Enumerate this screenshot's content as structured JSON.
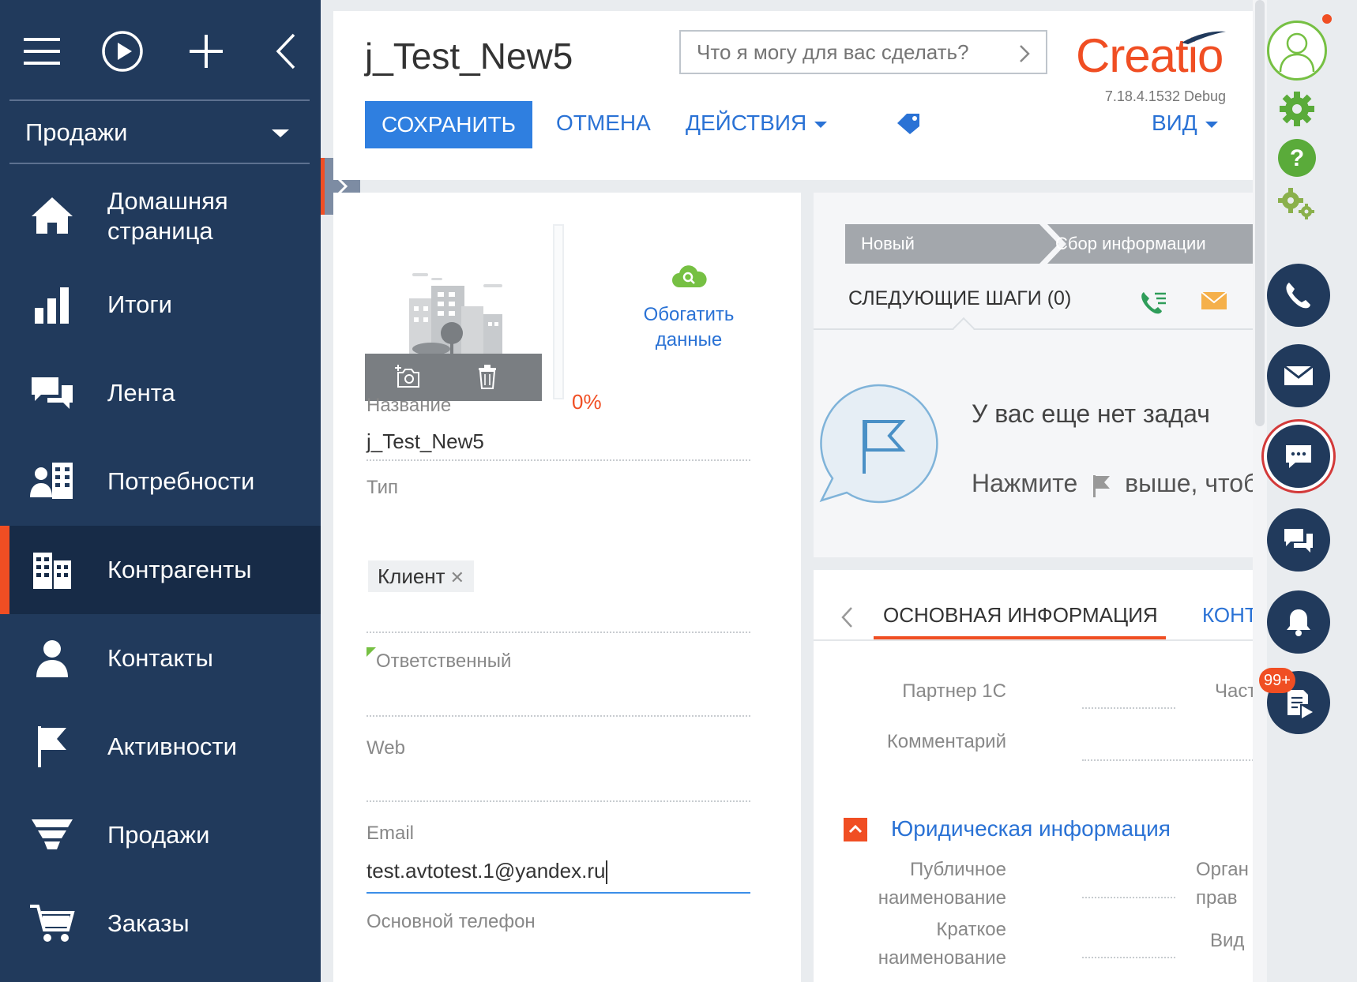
{
  "sidebar": {
    "section": "Продажи",
    "items": [
      {
        "label": "Домашняя страница",
        "icon": "home-icon"
      },
      {
        "label": "Итоги",
        "icon": "bar-chart-icon"
      },
      {
        "label": "Лента",
        "icon": "chat-bubbles-icon"
      },
      {
        "label": "Потребности",
        "icon": "needs-icon"
      },
      {
        "label": "Контрагенты",
        "icon": "buildings-icon",
        "active": true
      },
      {
        "label": "Контакты",
        "icon": "person-icon"
      },
      {
        "label": "Активности",
        "icon": "flag-icon"
      },
      {
        "label": "Продажи",
        "icon": "funnel-icon"
      },
      {
        "label": "Заказы",
        "icon": "cart-icon"
      }
    ]
  },
  "header": {
    "title": "j_Test_New5",
    "search_placeholder": "Что я могу для вас сделать?",
    "logo": "Creatio",
    "version": "7.18.4.1532 Debug",
    "save_label": "СОХРАНИТЬ",
    "cancel_label": "ОТМЕНА",
    "actions_label": "ДЕЙСТВИЯ",
    "view_label": "ВИД"
  },
  "profile": {
    "progress_percent": 0,
    "progress_label": "0%",
    "enrich_label": "Обогатить данные"
  },
  "form": {
    "name_label": "Название",
    "name_value": "j_Test_New5",
    "type_label": "Тип",
    "type_value": "Клиент",
    "owner_label": "Ответственный",
    "web_label": "Web",
    "email_label": "Email",
    "email_value": "test.avtotest.1@yandex.ru",
    "phone_label": "Основной телефон"
  },
  "steps": {
    "stages": [
      "Новый",
      "Сбор информации"
    ],
    "next_steps_label": "СЛЕДУЮЩИЕ ШАГИ (0)",
    "empty_title": "У вас еще нет задач",
    "empty_hint_before": "Нажмите",
    "empty_hint_after": "выше, чтоб"
  },
  "info": {
    "tabs": [
      "ОСНОВНАЯ ИНФОРМАЦИЯ",
      "КОНТ"
    ],
    "partner_label": "Партнер 1С",
    "part_label": "Част",
    "comment_label": "Комментарий",
    "legal_section": "Юридическая информация",
    "public_name_label": "Публичное наименование",
    "org_label": "Орган прав",
    "short_name_label": "Краткое наименование",
    "kind_label": "Вид"
  },
  "rail": {
    "notifications_badge": "99+"
  },
  "colors": {
    "sidebar_bg": "#213a5c",
    "accent": "#f04e23",
    "link": "#2a72d5",
    "primary_button": "#2f7fe0",
    "success": "#76c043"
  }
}
